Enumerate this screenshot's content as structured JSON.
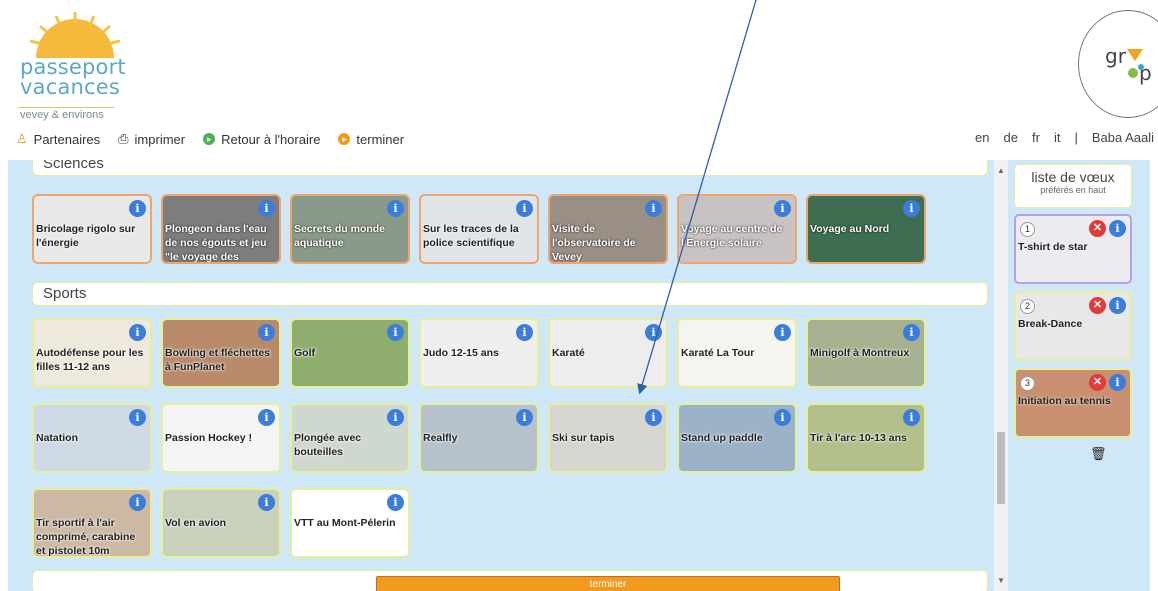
{
  "logo": {
    "line1": "passeport",
    "line2": "vacances",
    "line3": "vevey & environs"
  },
  "partner_logo": {
    "text1": "gr",
    "text2": "p"
  },
  "toolbar": {
    "partners": "Partenaires",
    "print": "imprimer",
    "back": "Retour à l'horaire",
    "finish": "terminer"
  },
  "languages": [
    "en",
    "de",
    "fr",
    "it"
  ],
  "separator": "|",
  "user_name": "Baba Aaali",
  "sections": {
    "sciences": "Sciences",
    "sports": "Sports"
  },
  "science_tiles": [
    {
      "label": "Bricolage rigolo sur l'énergie",
      "bg": "#e8e8e8",
      "dark": false
    },
    {
      "label": "Plongeon dans l'eau de nos égouts et jeu \"le voyage des",
      "bg": "#7d7d7d",
      "dark": true
    },
    {
      "label": "Secrets du monde aquatique",
      "bg": "#8a9a8a",
      "dark": true
    },
    {
      "label": "Sur les traces de la police scientifique",
      "bg": "#dfe4e6",
      "dark": false
    },
    {
      "label": "Visite de l'observatoire de Vevey",
      "bg": "#9a8f84",
      "dark": true
    },
    {
      "label": "Voyage au centre de l'Energie solaire",
      "bg": "#c9c2c2",
      "dark": true
    },
    {
      "label": "Voyage au Nord",
      "bg": "#3e6e52",
      "dark": true
    }
  ],
  "sport_tiles": [
    {
      "label": "Autodéfense pour les filles 11-12 ans",
      "bg": "#eee9dc"
    },
    {
      "label": "Bowling et fléchettes à FunPlanet",
      "bg": "#b98a6a"
    },
    {
      "label": "Golf",
      "bg": "#8fae6e"
    },
    {
      "label": "Judo 12-15 ans",
      "bg": "#efefef"
    },
    {
      "label": "Karaté",
      "bg": "#ededed"
    },
    {
      "label": "Karaté La Tour",
      "bg": "#f6f4ef"
    },
    {
      "label": "Minigolf à Montreux",
      "bg": "#a6b28f"
    },
    {
      "label": "Natation",
      "bg": "#cfd9e6"
    },
    {
      "label": "Passion Hockey !",
      "bg": "#f4f4f4"
    },
    {
      "label": "Plongée avec bouteilles",
      "bg": "#cfd8cf"
    },
    {
      "label": "Realfly",
      "bg": "#b5c2cc"
    },
    {
      "label": "Ski sur tapis",
      "bg": "#d6d6d0"
    },
    {
      "label": "Stand up paddle",
      "bg": "#9cb2c8"
    },
    {
      "label": "Tir à l'arc 10-13 ans",
      "bg": "#b3c08c"
    },
    {
      "label": "Tir sportif à l'air comprimé, carabine et pistolet 10m",
      "bg": "#cdb9a3"
    },
    {
      "label": "Vol en avion",
      "bg": "#c9d1bd"
    },
    {
      "label": "VTT au Mont-Pélerin",
      "bg": "#ffffff"
    }
  ],
  "wishlist": {
    "title": "liste de vœux",
    "subtitle": "préférés en haut",
    "items": [
      {
        "num": "1",
        "label": "T-shirt de star",
        "bg": "#ecebf0"
      },
      {
        "num": "2",
        "label": "Break-Dance",
        "bg": "#e8e8e8"
      },
      {
        "num": "3",
        "label": "Initiation au tennis",
        "bg": "#c89070"
      }
    ]
  },
  "finish_button": "terminer",
  "icons": {
    "info": "info-icon",
    "remove": "close-icon",
    "trash": "trash-icon",
    "print": "printer-icon",
    "partners": "people-icon",
    "back": "circle-arrow-icon",
    "finish": "circle-arrow-icon"
  },
  "colors": {
    "panel_bg": "#cfe8f8",
    "science_border": "#f0a46a",
    "sport_border": "#e6ee9a",
    "info_blue": "#3b7dd8",
    "finish_orange": "#f29a1e",
    "remove_red": "#e23b3b"
  }
}
